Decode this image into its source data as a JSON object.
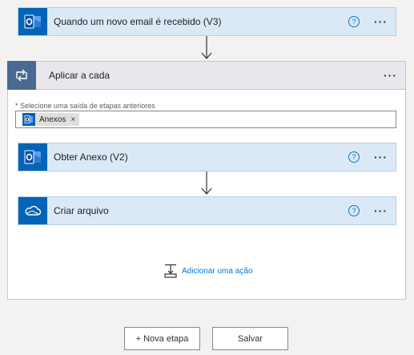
{
  "trigger": {
    "title": "Quando um novo email é recebido (V3)",
    "help": "?",
    "more": "···"
  },
  "loop": {
    "title": "Aplicar a cada",
    "more": "···",
    "field_required_mark": "*",
    "field_label": "Selecione uma saída de etapas anteriores",
    "token_label": "Anexos",
    "token_remove": "×"
  },
  "inner_steps": [
    {
      "title": "Obter Anexo (V2)",
      "help": "?",
      "more": "···",
      "icon": "outlook-icon"
    },
    {
      "title": "Criar arquivo",
      "help": "?",
      "more": "···",
      "icon": "onedrive-icon"
    }
  ],
  "add_action": {
    "label": "Adicionar uma ação"
  },
  "footer": {
    "new_step_label": "+ Nova etapa",
    "save_label": "Salvar"
  },
  "colors": {
    "outlook_blue": "#0364b8",
    "loop_tile": "#486991",
    "step_bg": "#dbe9f6",
    "link_blue": "#0078d4"
  }
}
